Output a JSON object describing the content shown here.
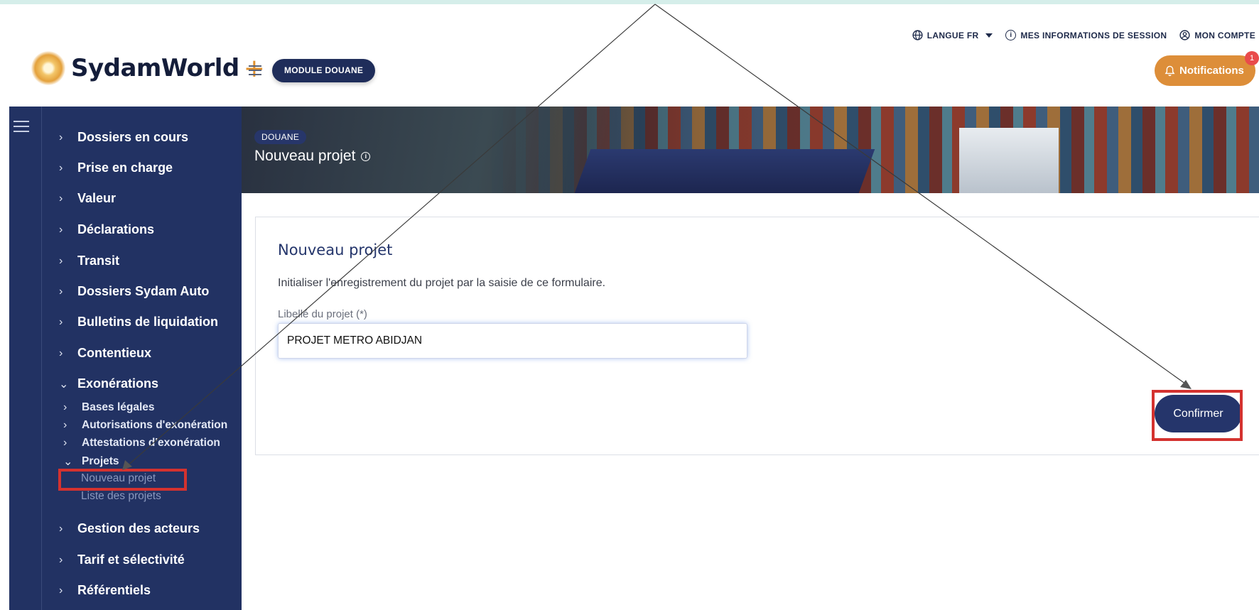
{
  "header": {
    "brand": "SydamWorld",
    "brand_plus": "+",
    "module_button": "MODULE DOUANE",
    "nav": {
      "language": "LANGUE FR",
      "session_info": "MES INFORMATIONS DE SESSION",
      "account": "MON COMPTE"
    },
    "notifications_label": "Notifications",
    "notifications_count": "1"
  },
  "sidebar": {
    "items": [
      {
        "label": "Dossiers en cours",
        "chevron": ">"
      },
      {
        "label": "Prise en charge",
        "chevron": ">"
      },
      {
        "label": "Valeur",
        "chevron": ">"
      },
      {
        "label": "Déclarations",
        "chevron": ">"
      },
      {
        "label": "Transit",
        "chevron": ">"
      },
      {
        "label": "Dossiers Sydam Auto",
        "chevron": ">"
      },
      {
        "label": "Bulletins de liquidation",
        "chevron": ">"
      },
      {
        "label": "Contentieux",
        "chevron": ">"
      },
      {
        "label": "Exonérations",
        "chevron": "v"
      },
      {
        "label": "Gestion des acteurs",
        "chevron": ">"
      },
      {
        "label": "Tarif et sélectivité",
        "chevron": ">"
      },
      {
        "label": "Référentiels",
        "chevron": ">"
      }
    ],
    "exonerations_sub": [
      {
        "label": "Bases légales",
        "chevron": ">"
      },
      {
        "label": "Autorisations d'exonération",
        "chevron": ">"
      },
      {
        "label": "Attestations d'exonération",
        "chevron": ">"
      },
      {
        "label": "Projets",
        "chevron": "v"
      }
    ],
    "projets_sub": [
      "Nouveau projet",
      "Liste des projets"
    ]
  },
  "banner": {
    "tag": "DOUANE",
    "title": "Nouveau projet",
    "info_icon": "info-icon"
  },
  "form": {
    "title": "Nouveau projet",
    "description": "Initialiser l'enregistrement du projet par la saisie de ce formulaire.",
    "field_label": "Libellé du projet (*)",
    "field_value": "PROJET METRO ABIDJAN",
    "confirm_label": "Confirmer"
  },
  "colors": {
    "sidebar_bg": "#223263",
    "accent_orange": "#dd8e39",
    "primary_button": "#25356b",
    "highlight_red": "#d4322f"
  }
}
